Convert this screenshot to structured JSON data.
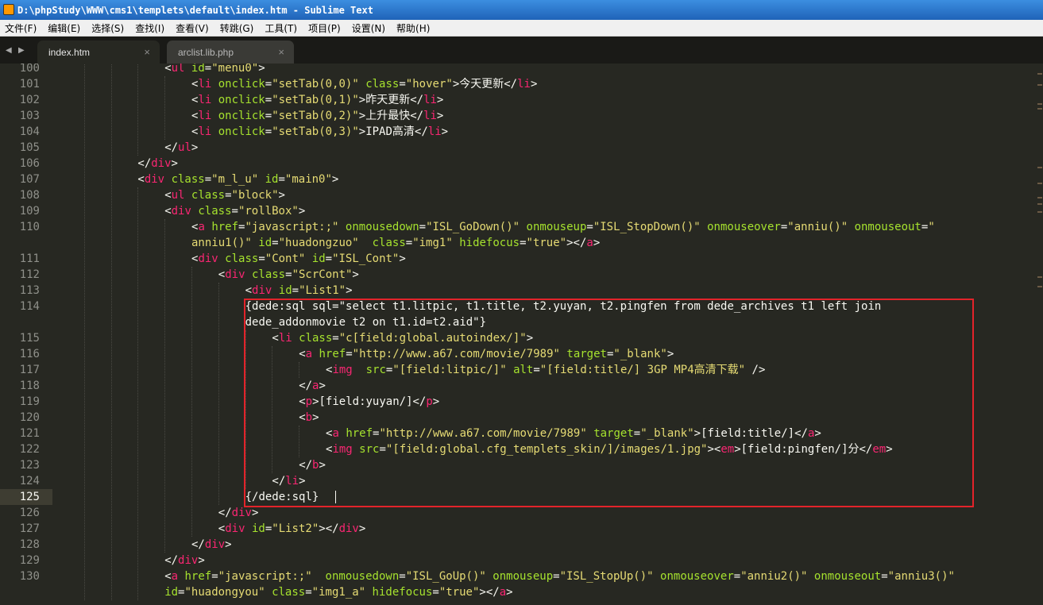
{
  "window": {
    "title": "D:\\phpStudy\\WWW\\cms1\\templets\\default\\index.htm - Sublime Text"
  },
  "menu": [
    "文件(F)",
    "编辑(E)",
    "选择(S)",
    "查找(I)",
    "查看(V)",
    "转跳(G)",
    "工具(T)",
    "项目(P)",
    "设置(N)",
    "帮助(H)"
  ],
  "nav": {
    "back": "◀",
    "forward": "▶"
  },
  "tabs": [
    {
      "label": "index.htm",
      "close": "×"
    },
    {
      "label": "arclist.lib.php",
      "close": "×"
    }
  ],
  "current_line": "125",
  "lines": [
    {
      "n": "100",
      "row": 0,
      "indent": 4,
      "tokens": [
        [
          "p",
          "<"
        ],
        [
          "t",
          "ul"
        ],
        [
          "p",
          " "
        ],
        [
          "a",
          "id"
        ],
        [
          "p",
          "="
        ],
        [
          "s",
          "\"menu0\""
        ],
        [
          "p",
          ">"
        ]
      ]
    },
    {
      "n": "101",
      "row": 1,
      "indent": 5,
      "tokens": [
        [
          "p",
          "<"
        ],
        [
          "t",
          "li"
        ],
        [
          "p",
          " "
        ],
        [
          "a",
          "onclick"
        ],
        [
          "p",
          "="
        ],
        [
          "s",
          "\"setTab(0,0)\""
        ],
        [
          "p",
          " "
        ],
        [
          "a",
          "class"
        ],
        [
          "p",
          "="
        ],
        [
          "s",
          "\"hover\""
        ],
        [
          "p",
          ">今天更新</"
        ],
        [
          "t",
          "li"
        ],
        [
          "p",
          ">"
        ]
      ]
    },
    {
      "n": "102",
      "row": 2,
      "indent": 5,
      "tokens": [
        [
          "p",
          "<"
        ],
        [
          "t",
          "li"
        ],
        [
          "p",
          " "
        ],
        [
          "a",
          "onclick"
        ],
        [
          "p",
          "="
        ],
        [
          "s",
          "\"setTab(0,1)\""
        ],
        [
          "p",
          ">昨天更新</"
        ],
        [
          "t",
          "li"
        ],
        [
          "p",
          ">"
        ]
      ]
    },
    {
      "n": "103",
      "row": 3,
      "indent": 5,
      "tokens": [
        [
          "p",
          "<"
        ],
        [
          "t",
          "li"
        ],
        [
          "p",
          " "
        ],
        [
          "a",
          "onclick"
        ],
        [
          "p",
          "="
        ],
        [
          "s",
          "\"setTab(0,2)\""
        ],
        [
          "p",
          ">上升最快</"
        ],
        [
          "t",
          "li"
        ],
        [
          "p",
          ">"
        ]
      ]
    },
    {
      "n": "104",
      "row": 4,
      "indent": 5,
      "tokens": [
        [
          "p",
          "<"
        ],
        [
          "t",
          "li"
        ],
        [
          "p",
          " "
        ],
        [
          "a",
          "onclick"
        ],
        [
          "p",
          "="
        ],
        [
          "s",
          "\"setTab(0,3)\""
        ],
        [
          "p",
          ">IPAD高清</"
        ],
        [
          "t",
          "li"
        ],
        [
          "p",
          ">"
        ]
      ]
    },
    {
      "n": "105",
      "row": 5,
      "indent": 4,
      "tokens": [
        [
          "p",
          "</"
        ],
        [
          "t",
          "ul"
        ],
        [
          "p",
          ">"
        ]
      ]
    },
    {
      "n": "106",
      "row": 6,
      "indent": 3,
      "tokens": [
        [
          "p",
          "</"
        ],
        [
          "t",
          "div"
        ],
        [
          "p",
          ">"
        ]
      ]
    },
    {
      "n": "107",
      "row": 7,
      "indent": 3,
      "tokens": [
        [
          "p",
          "<"
        ],
        [
          "t",
          "div"
        ],
        [
          "p",
          " "
        ],
        [
          "a",
          "class"
        ],
        [
          "p",
          "="
        ],
        [
          "s",
          "\"m_l_u\""
        ],
        [
          "p",
          " "
        ],
        [
          "a",
          "id"
        ],
        [
          "p",
          "="
        ],
        [
          "s",
          "\"main0\""
        ],
        [
          "p",
          ">"
        ]
      ]
    },
    {
      "n": "108",
      "row": 8,
      "indent": 4,
      "tokens": [
        [
          "p",
          "<"
        ],
        [
          "t",
          "ul"
        ],
        [
          "p",
          " "
        ],
        [
          "a",
          "class"
        ],
        [
          "p",
          "="
        ],
        [
          "s",
          "\"block\""
        ],
        [
          "p",
          ">"
        ]
      ]
    },
    {
      "n": "109",
      "row": 9,
      "indent": 4,
      "tokens": [
        [
          "p",
          "<"
        ],
        [
          "t",
          "div"
        ],
        [
          "p",
          " "
        ],
        [
          "a",
          "class"
        ],
        [
          "p",
          "="
        ],
        [
          "s",
          "\"rollBox\""
        ],
        [
          "p",
          ">"
        ]
      ]
    },
    {
      "n": "110",
      "row": 10,
      "indent": 5,
      "tokens": [
        [
          "p",
          "<"
        ],
        [
          "t",
          "a"
        ],
        [
          "p",
          " "
        ],
        [
          "a",
          "href"
        ],
        [
          "p",
          "="
        ],
        [
          "s",
          "\"javascript:;\""
        ],
        [
          "p",
          " "
        ],
        [
          "a",
          "onmousedown"
        ],
        [
          "p",
          "="
        ],
        [
          "s",
          "\"ISL_GoDown()\""
        ],
        [
          "p",
          " "
        ],
        [
          "a",
          "onmouseup"
        ],
        [
          "p",
          "="
        ],
        [
          "s",
          "\"ISL_StopDown()\""
        ],
        [
          "p",
          " "
        ],
        [
          "a",
          "onmouseover"
        ],
        [
          "p",
          "="
        ],
        [
          "s",
          "\"anniu()\""
        ],
        [
          "p",
          " "
        ],
        [
          "a",
          "onmouseout"
        ],
        [
          "p",
          "="
        ],
        [
          "s",
          "\""
        ]
      ]
    },
    {
      "n": "",
      "row": 11,
      "indent": 5,
      "tokens": [
        [
          "s",
          "anniu1()\""
        ],
        [
          "p",
          " "
        ],
        [
          "a",
          "id"
        ],
        [
          "p",
          "="
        ],
        [
          "s",
          "\"huadongzuo\""
        ],
        [
          "p",
          "  "
        ],
        [
          "a",
          "class"
        ],
        [
          "p",
          "="
        ],
        [
          "s",
          "\"img1\""
        ],
        [
          "p",
          " "
        ],
        [
          "a",
          "hidefocus"
        ],
        [
          "p",
          "="
        ],
        [
          "s",
          "\"true\""
        ],
        [
          "p",
          "></"
        ],
        [
          "t",
          "a"
        ],
        [
          "p",
          ">"
        ]
      ]
    },
    {
      "n": "111",
      "row": 12,
      "indent": 5,
      "tokens": [
        [
          "p",
          "<"
        ],
        [
          "t",
          "div"
        ],
        [
          "p",
          " "
        ],
        [
          "a",
          "class"
        ],
        [
          "p",
          "="
        ],
        [
          "s",
          "\"Cont\""
        ],
        [
          "p",
          " "
        ],
        [
          "a",
          "id"
        ],
        [
          "p",
          "="
        ],
        [
          "s",
          "\"ISL_Cont\""
        ],
        [
          "p",
          ">"
        ]
      ]
    },
    {
      "n": "112",
      "row": 13,
      "indent": 6,
      "tokens": [
        [
          "p",
          "<"
        ],
        [
          "t",
          "div"
        ],
        [
          "p",
          " "
        ],
        [
          "a",
          "class"
        ],
        [
          "p",
          "="
        ],
        [
          "s",
          "\"ScrCont\""
        ],
        [
          "p",
          ">"
        ]
      ]
    },
    {
      "n": "113",
      "row": 14,
      "indent": 7,
      "tokens": [
        [
          "p",
          "<"
        ],
        [
          "t",
          "div"
        ],
        [
          "p",
          " "
        ],
        [
          "a",
          "id"
        ],
        [
          "p",
          "="
        ],
        [
          "s",
          "\"List1\""
        ],
        [
          "p",
          ">"
        ]
      ]
    },
    {
      "n": "114",
      "row": 15,
      "indent": 7,
      "tokens": [
        [
          "p",
          "{dede:sql sql=\"select t1.litpic, t1.title, t2.yuyan, t2.pingfen from dede_archives t1 left join"
        ]
      ]
    },
    {
      "n": "",
      "row": 16,
      "indent": 7,
      "tokens": [
        [
          "p",
          "dede_addonmovie t2 on t1.id=t2.aid\"}"
        ]
      ]
    },
    {
      "n": "115",
      "row": 17,
      "indent": 8,
      "tokens": [
        [
          "p",
          "<"
        ],
        [
          "t",
          "li"
        ],
        [
          "p",
          " "
        ],
        [
          "a",
          "class"
        ],
        [
          "p",
          "="
        ],
        [
          "s",
          "\"c[field:global.autoindex/]\""
        ],
        [
          "p",
          ">"
        ]
      ]
    },
    {
      "n": "116",
      "row": 18,
      "indent": 9,
      "tokens": [
        [
          "p",
          "<"
        ],
        [
          "t",
          "a"
        ],
        [
          "p",
          " "
        ],
        [
          "a",
          "href"
        ],
        [
          "p",
          "="
        ],
        [
          "s",
          "\"http://www.a67.com/movie/7989\""
        ],
        [
          "p",
          " "
        ],
        [
          "a",
          "target"
        ],
        [
          "p",
          "="
        ],
        [
          "s",
          "\"_blank\""
        ],
        [
          "p",
          ">"
        ]
      ]
    },
    {
      "n": "117",
      "row": 19,
      "indent": 10,
      "tokens": [
        [
          "p",
          "<"
        ],
        [
          "t",
          "img"
        ],
        [
          "p",
          "  "
        ],
        [
          "a",
          "src"
        ],
        [
          "p",
          "="
        ],
        [
          "s",
          "\"[field:litpic/]\""
        ],
        [
          "p",
          " "
        ],
        [
          "a",
          "alt"
        ],
        [
          "p",
          "="
        ],
        [
          "s",
          "\"[field:title/] 3GP MP4高清下载\""
        ],
        [
          "p",
          " />"
        ]
      ]
    },
    {
      "n": "118",
      "row": 20,
      "indent": 9,
      "tokens": [
        [
          "p",
          "</"
        ],
        [
          "t",
          "a"
        ],
        [
          "p",
          ">"
        ]
      ]
    },
    {
      "n": "119",
      "row": 21,
      "indent": 9,
      "tokens": [
        [
          "p",
          "<"
        ],
        [
          "t",
          "p"
        ],
        [
          "p",
          ">[field:yuyan/]</"
        ],
        [
          "t",
          "p"
        ],
        [
          "p",
          ">"
        ]
      ]
    },
    {
      "n": "120",
      "row": 22,
      "indent": 9,
      "tokens": [
        [
          "p",
          "<"
        ],
        [
          "t",
          "b"
        ],
        [
          "p",
          ">"
        ]
      ]
    },
    {
      "n": "121",
      "row": 23,
      "indent": 10,
      "tokens": [
        [
          "p",
          "<"
        ],
        [
          "t",
          "a"
        ],
        [
          "p",
          " "
        ],
        [
          "a",
          "href"
        ],
        [
          "p",
          "="
        ],
        [
          "s",
          "\"http://www.a67.com/movie/7989\""
        ],
        [
          "p",
          " "
        ],
        [
          "a",
          "target"
        ],
        [
          "p",
          "="
        ],
        [
          "s",
          "\"_blank\""
        ],
        [
          "p",
          ">[field:title/]</"
        ],
        [
          "t",
          "a"
        ],
        [
          "p",
          ">"
        ]
      ]
    },
    {
      "n": "122",
      "row": 24,
      "indent": 10,
      "tokens": [
        [
          "p",
          "<"
        ],
        [
          "t",
          "img"
        ],
        [
          "p",
          " "
        ],
        [
          "a",
          "src"
        ],
        [
          "p",
          "="
        ],
        [
          "s",
          "\"[field:global.cfg_templets_skin/]/images/1.jpg\""
        ],
        [
          "p",
          "><"
        ],
        [
          "t",
          "em"
        ],
        [
          "p",
          ">[field:pingfen/]分</"
        ],
        [
          "t",
          "em"
        ],
        [
          "p",
          ">"
        ]
      ]
    },
    {
      "n": "123",
      "row": 25,
      "indent": 9,
      "tokens": [
        [
          "p",
          "</"
        ],
        [
          "t",
          "b"
        ],
        [
          "p",
          ">"
        ]
      ]
    },
    {
      "n": "124",
      "row": 26,
      "indent": 8,
      "tokens": [
        [
          "p",
          "</"
        ],
        [
          "t",
          "li"
        ],
        [
          "p",
          ">"
        ]
      ]
    },
    {
      "n": "125",
      "row": 27,
      "indent": 7,
      "tokens": [
        [
          "p",
          "{/dede:sql}"
        ]
      ]
    },
    {
      "n": "126",
      "row": 28,
      "indent": 6,
      "tokens": [
        [
          "p",
          "</"
        ],
        [
          "t",
          "div"
        ],
        [
          "p",
          ">"
        ]
      ]
    },
    {
      "n": "127",
      "row": 29,
      "indent": 6,
      "tokens": [
        [
          "p",
          "<"
        ],
        [
          "t",
          "div"
        ],
        [
          "p",
          " "
        ],
        [
          "a",
          "id"
        ],
        [
          "p",
          "="
        ],
        [
          "s",
          "\"List2\""
        ],
        [
          "p",
          "></"
        ],
        [
          "t",
          "div"
        ],
        [
          "p",
          ">"
        ]
      ]
    },
    {
      "n": "128",
      "row": 30,
      "indent": 5,
      "tokens": [
        [
          "p",
          "</"
        ],
        [
          "t",
          "div"
        ],
        [
          "p",
          ">"
        ]
      ]
    },
    {
      "n": "129",
      "row": 31,
      "indent": 4,
      "tokens": [
        [
          "p",
          "</"
        ],
        [
          "t",
          "div"
        ],
        [
          "p",
          ">"
        ]
      ]
    },
    {
      "n": "130",
      "row": 32,
      "indent": 4,
      "tokens": [
        [
          "p",
          "<"
        ],
        [
          "t",
          "a"
        ],
        [
          "p",
          " "
        ],
        [
          "a",
          "href"
        ],
        [
          "p",
          "="
        ],
        [
          "s",
          "\"javascript:;\""
        ],
        [
          "p",
          "  "
        ],
        [
          "a",
          "onmousedown"
        ],
        [
          "p",
          "="
        ],
        [
          "s",
          "\"ISL_GoUp()\""
        ],
        [
          "p",
          " "
        ],
        [
          "a",
          "onmouseup"
        ],
        [
          "p",
          "="
        ],
        [
          "s",
          "\"ISL_StopUp()\""
        ],
        [
          "p",
          " "
        ],
        [
          "a",
          "onmouseover"
        ],
        [
          "p",
          "="
        ],
        [
          "s",
          "\"anniu2()\""
        ],
        [
          "p",
          " "
        ],
        [
          "a",
          "onmouseout"
        ],
        [
          "p",
          "="
        ],
        [
          "s",
          "\"anniu3()\""
        ]
      ]
    },
    {
      "n": "",
      "row": 33,
      "indent": 4,
      "tokens": [
        [
          "a",
          "id"
        ],
        [
          "p",
          "="
        ],
        [
          "s",
          "\"huadongyou\""
        ],
        [
          "p",
          " "
        ],
        [
          "a",
          "class"
        ],
        [
          "p",
          "="
        ],
        [
          "s",
          "\"img1_a\""
        ],
        [
          "p",
          " "
        ],
        [
          "a",
          "hidefocus"
        ],
        [
          "p",
          "="
        ],
        [
          "s",
          "\"true\""
        ],
        [
          "p",
          "></"
        ],
        [
          "t",
          "a"
        ],
        [
          "p",
          ">"
        ]
      ]
    }
  ],
  "colors": {
    "background": "#272822",
    "tag": "#f92672",
    "attribute": "#a6e22e",
    "string": "#e6db74",
    "text": "#f8f8f2",
    "highlight_box": "#e3232a"
  }
}
